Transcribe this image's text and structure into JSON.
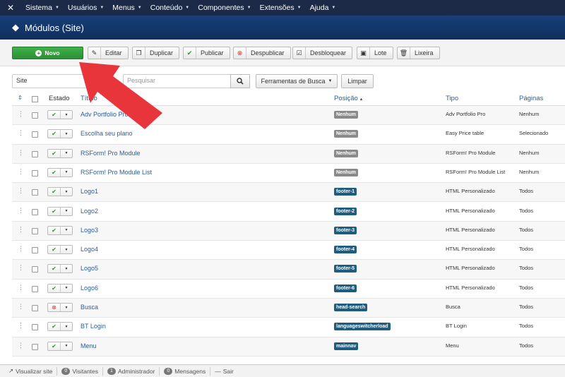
{
  "topnav": {
    "menu": [
      {
        "label": "Sistema"
      },
      {
        "label": "Usuários"
      },
      {
        "label": "Menus"
      },
      {
        "label": "Conteúdo"
      },
      {
        "label": "Componentes"
      },
      {
        "label": "Extensões"
      },
      {
        "label": "Ajuda"
      }
    ]
  },
  "header": {
    "title": "Módulos (Site)"
  },
  "toolbar": {
    "new_label": "Novo",
    "buttons": [
      {
        "label": "Editar",
        "icon": "edit-icon"
      },
      {
        "label": "Duplicar",
        "icon": "copy-icon"
      },
      {
        "label": "Publicar",
        "icon": "check-icon"
      },
      {
        "label": "Despublicar",
        "icon": "unpublish-icon"
      },
      {
        "label": "Desbloquear",
        "icon": "checkin-icon"
      },
      {
        "label": "Lote",
        "icon": "batch-icon"
      },
      {
        "label": "Lixeira",
        "icon": "trash-icon"
      }
    ]
  },
  "filters": {
    "client_value": "Site",
    "search_placeholder": "Pesquisar",
    "tools_label": "Ferramentas de Busca",
    "clear_label": "Limpar"
  },
  "table": {
    "columns": {
      "status": "Estado",
      "title": "Título",
      "position": "Posição",
      "type": "Tipo",
      "pages": "Páginas"
    },
    "rows": [
      {
        "title": "Adv Portfolio Pro",
        "position": "Nenhum",
        "pos_set": false,
        "type": "Adv Portfolio Pro",
        "pages": "Nenhum",
        "published": true
      },
      {
        "title": "Escolha seu plano",
        "position": "Nenhum",
        "pos_set": false,
        "type": "Easy Price table",
        "pages": "Selecionado",
        "published": true
      },
      {
        "title": "RSForm! Pro Module",
        "position": "Nenhum",
        "pos_set": false,
        "type": "RSForm! Pro Module",
        "pages": "Nenhum",
        "published": true
      },
      {
        "title": "RSForm! Pro Module List",
        "position": "Nenhum",
        "pos_set": false,
        "type": "RSForm! Pro Module List",
        "pages": "Nenhum",
        "published": true
      },
      {
        "title": "Logo1",
        "position": "footer-1",
        "pos_set": true,
        "type": "HTML Personalizado",
        "pages": "Todos",
        "published": true
      },
      {
        "title": "Logo2",
        "position": "footer-2",
        "pos_set": true,
        "type": "HTML Personalizado",
        "pages": "Todos",
        "published": true
      },
      {
        "title": "Logo3",
        "position": "footer-3",
        "pos_set": true,
        "type": "HTML Personalizado",
        "pages": "Todos",
        "published": true
      },
      {
        "title": "Logo4",
        "position": "footer-4",
        "pos_set": true,
        "type": "HTML Personalizado",
        "pages": "Todos",
        "published": true
      },
      {
        "title": "Logo5",
        "position": "footer-5",
        "pos_set": true,
        "type": "HTML Personalizado",
        "pages": "Todos",
        "published": true
      },
      {
        "title": "Logo6",
        "position": "footer-6",
        "pos_set": true,
        "type": "HTML Personalizado",
        "pages": "Todos",
        "published": true
      },
      {
        "title": "Busca",
        "position": "head-search",
        "pos_set": true,
        "type": "Busca",
        "pages": "Todos",
        "published": false
      },
      {
        "title": "BT Login",
        "position": "languageswitcherload",
        "pos_set": true,
        "type": "BT Login",
        "pages": "Todos",
        "published": true
      },
      {
        "title": "Menu",
        "position": "mainnav",
        "pos_set": true,
        "type": "Menu",
        "pages": "Todos",
        "published": true
      }
    ]
  },
  "footer": {
    "view_site": "Visualizar site",
    "visitors_count": "0",
    "visitors": "Visitantes",
    "admins_count": "1",
    "admins": "Administrador",
    "messages_count": "0",
    "messages": "Mensagens",
    "logout": "Sair"
  },
  "colors": {
    "accent": "#2a5f9e",
    "header": "#11305e",
    "new_button": "#2c8f37",
    "arrow": "#e8343b"
  }
}
